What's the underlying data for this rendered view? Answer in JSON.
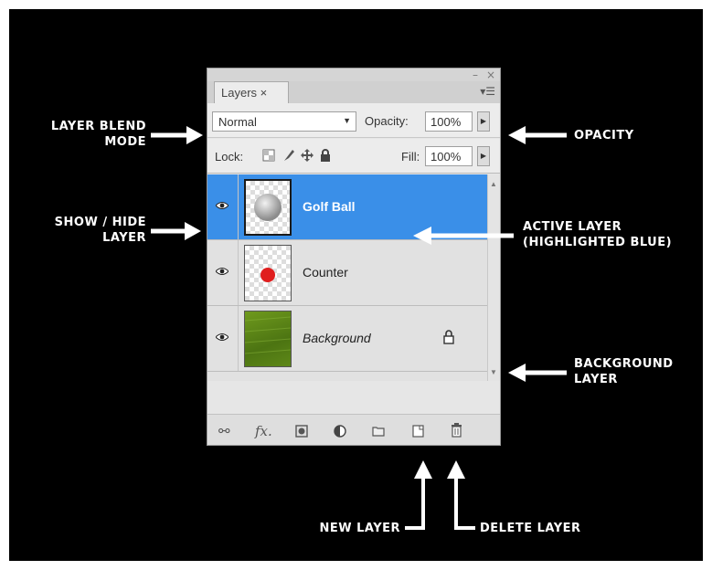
{
  "panel": {
    "tab_label": "Layers ×",
    "window_controls": {
      "minimize": "–",
      "close": "×"
    },
    "menu_icon": "panel-menu-icon"
  },
  "blend": {
    "mode": "Normal",
    "opacity_label": "Opacity:",
    "opacity_value": "100%"
  },
  "lock": {
    "label": "Lock:",
    "icons": [
      "lock-transparent-icon",
      "lock-paint-icon",
      "lock-move-icon",
      "lock-all-icon"
    ],
    "fill_label": "Fill:",
    "fill_value": "100%"
  },
  "layers": [
    {
      "name": "Golf Ball",
      "active": true,
      "thumb": "golf-ball"
    },
    {
      "name": "Counter",
      "active": false,
      "thumb": "red-dot"
    },
    {
      "name": "Background",
      "active": false,
      "thumb": "grass",
      "locked": true
    }
  ],
  "bottom_bar": {
    "icons": [
      "link-layers-icon",
      "fx-icon",
      "layer-mask-icon",
      "adjustment-layer-icon",
      "group-folder-icon",
      "new-layer-icon",
      "trash-icon"
    ],
    "fx_label": "fx."
  },
  "callouts": {
    "blend_mode": [
      "LAYER BLEND",
      "MODE"
    ],
    "show_hide": [
      "SHOW / HIDE",
      "LAYER"
    ],
    "opacity": [
      "OPACITY"
    ],
    "active_layer": [
      "ACTIVE LAYER",
      "(HIGHLIGHTED BLUE)"
    ],
    "background_layer": [
      "BACKGROUND",
      "LAYER"
    ],
    "new_layer": [
      "NEW LAYER"
    ],
    "delete_layer": [
      "DELETE LAYER"
    ]
  },
  "colors": {
    "active_highlight": "#3a8fe8",
    "background": "#000000",
    "callout_text": "#ffffff"
  }
}
